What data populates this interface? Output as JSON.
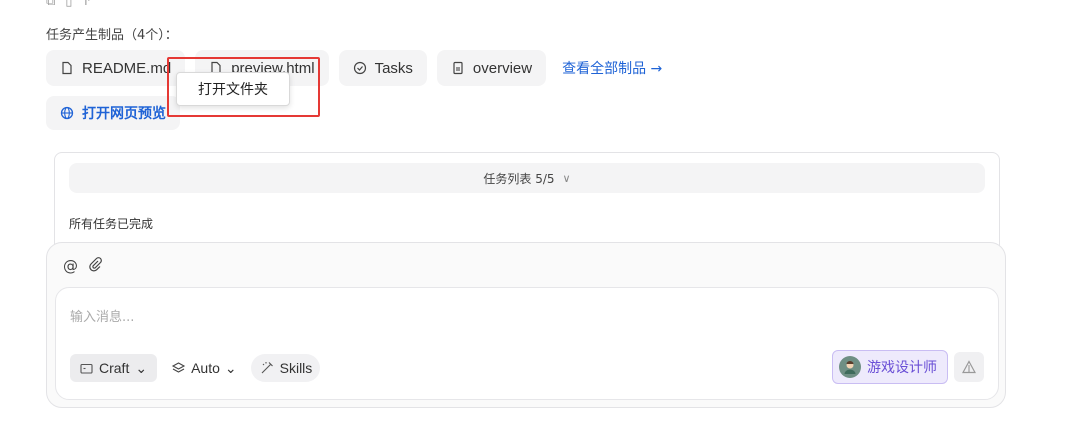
{
  "top_icons": [
    "copy-icon",
    "clipboard-icon",
    "share-icon"
  ],
  "artifacts": {
    "label": "任务产生制品（4个）：",
    "items": [
      {
        "label": "README.md",
        "icon": "file-icon"
      },
      {
        "label": "preview.html",
        "icon": "file-icon"
      },
      {
        "label": "Tasks",
        "icon": "check-circle-icon"
      },
      {
        "label": "overview",
        "icon": "document-icon"
      }
    ],
    "view_all": "查看全部制品 →"
  },
  "preview_button": {
    "label": "打开网页预览",
    "icon": "globe-icon"
  },
  "tooltip": {
    "label": "打开文件夹"
  },
  "highlight_color": "#e53935",
  "task_list": {
    "header": "任务列表 5/5",
    "status": "所有任务已完成"
  },
  "composer": {
    "placeholder": "输入消息...",
    "mode": "Craft",
    "model": "Auto",
    "skills": "Skills",
    "agent": "游戏设计师"
  },
  "colors": {
    "accent": "#1f63d6",
    "agent": "#6a4fd6"
  }
}
